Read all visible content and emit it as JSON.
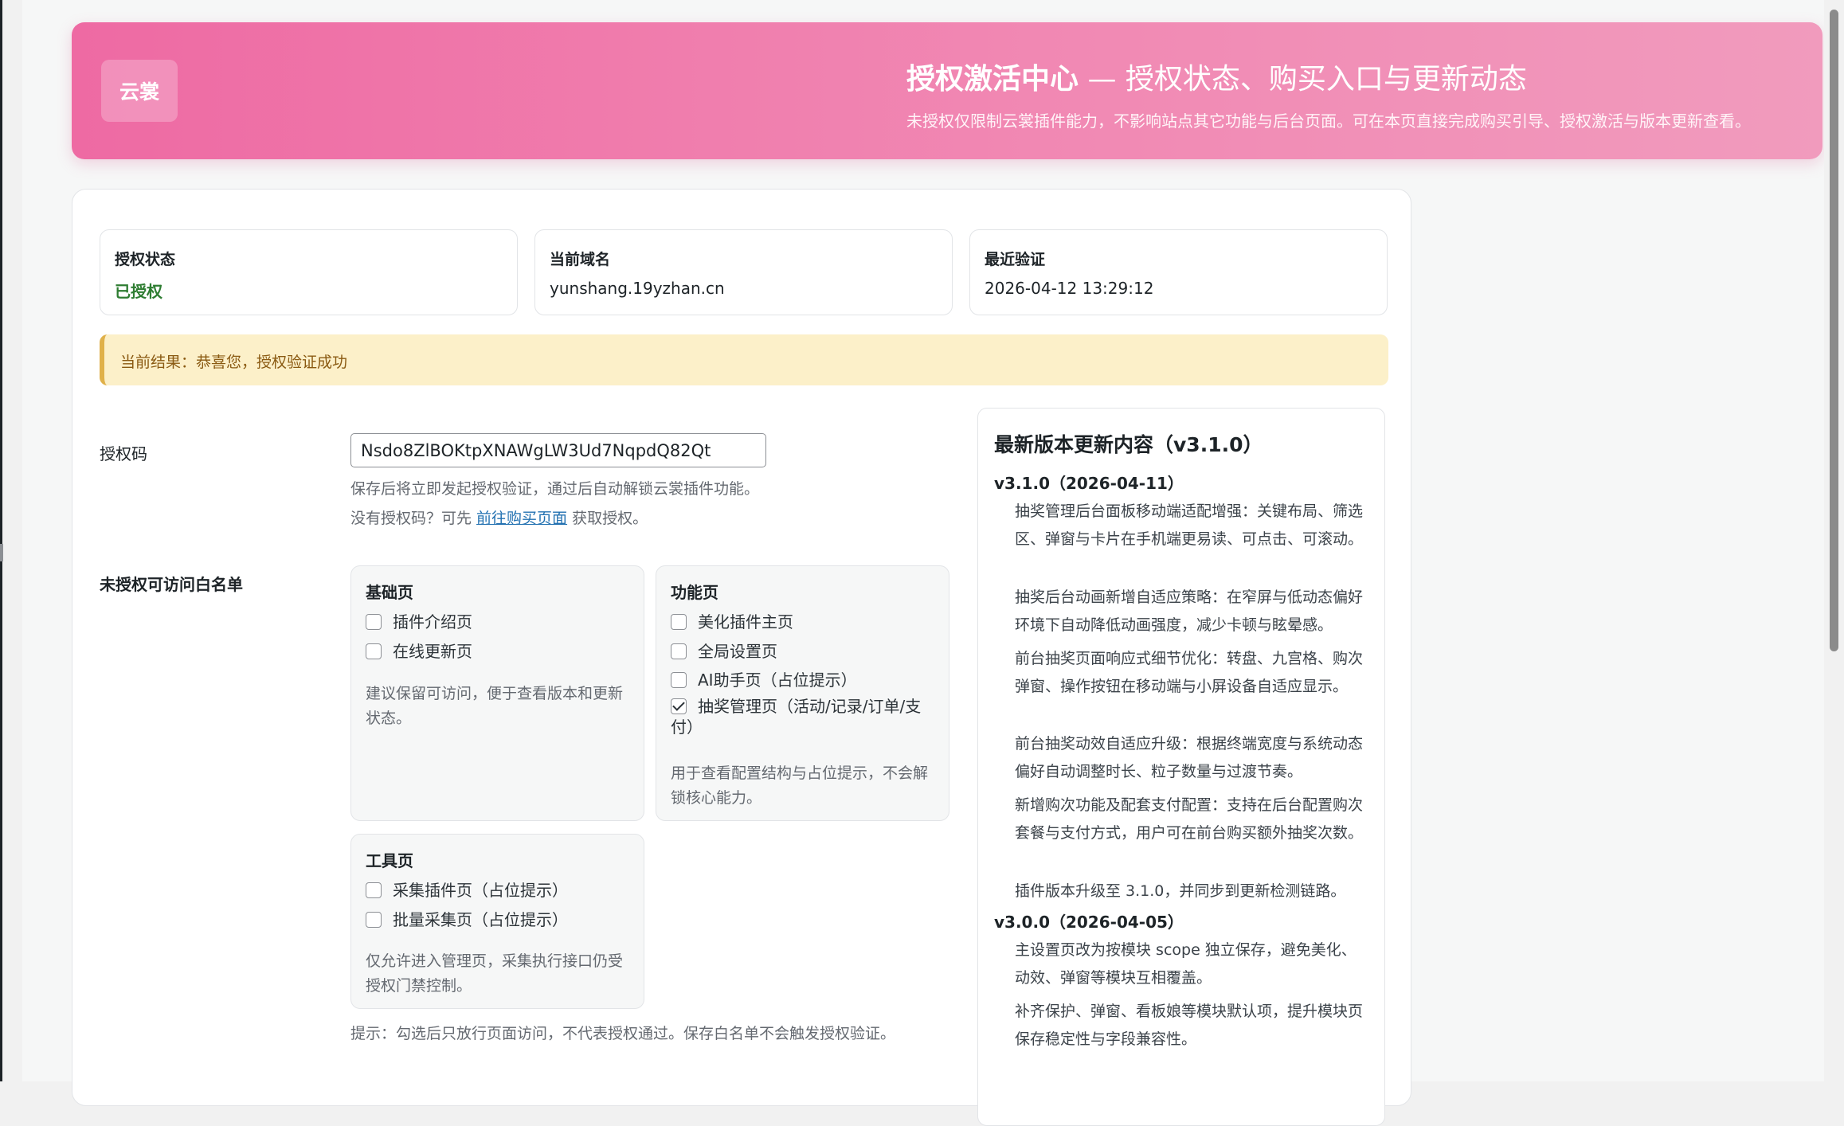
{
  "header": {
    "logo": "云裳",
    "title_main": "授权激活中心",
    "title_rest": " — 授权状态、购买入口与更新动态",
    "subtitle": "未授权仅限制云裳插件能力，不影响站点其它功能与后台页面。可在本页直接完成购买引导、授权激活与版本更新查看。"
  },
  "status_cards": [
    {
      "label": "授权状态",
      "value": "已授权"
    },
    {
      "label": "当前域名",
      "value": "yunshang.19yzhan.cn"
    },
    {
      "label": "最近验证",
      "value": "2026-04-12 13:29:12"
    }
  ],
  "notice": "当前结果：恭喜您，授权验证成功",
  "license": {
    "label": "授权码",
    "value": "Nsdo8ZlBOKtpXNAWgLW3Ud7NqpdQ82Qt",
    "help1": "保存后将立即发起授权验证，通过后自动解锁云裳插件功能。",
    "help2_prefix": "没有授权码？可先 ",
    "help2_link": "前往购买页面",
    "help2_suffix": " 获取授权。"
  },
  "whitelist": {
    "label": "未授权可访问白名单",
    "groups": [
      {
        "title": "基础页",
        "options": [
          {
            "label": "插件介绍页",
            "checked": false
          },
          {
            "label": "在线更新页",
            "checked": false
          }
        ],
        "note": "建议保留可访问，便于查看版本和更新状态。"
      },
      {
        "title": "功能页",
        "options": [
          {
            "label": "美化插件主页",
            "checked": false
          },
          {
            "label": "全局设置页",
            "checked": false
          },
          {
            "label": "AI助手页（占位提示）",
            "checked": false
          },
          {
            "label": "抽奖管理页（活动/记录/订单/支付）",
            "checked": true
          }
        ],
        "note": "用于查看配置结构与占位提示，不会解锁核心能力。"
      },
      {
        "title": "工具页",
        "options": [
          {
            "label": "采集插件页（占位提示）",
            "checked": false
          },
          {
            "label": "批量采集页（占位提示）",
            "checked": false
          }
        ],
        "note": "仅允许进入管理页，采集执行接口仍受授权门禁控制。"
      }
    ],
    "tip": "提示：勾选后只放行页面访问，不代表授权通过。保存白名单不会触发授权验证。"
  },
  "changelog": {
    "title": "最新版本更新内容（v3.1.0）",
    "versions": [
      {
        "version": "v3.1.0（2026-04-11）",
        "items": [
          "抽奖管理后台面板移动端适配增强：关键布局、筛选区、弹窗与卡片在手机端更易读、可点击、可滚动。",
          "抽奖后台动画新增自适应策略：在窄屏与低动态偏好环境下自动降低动画强度，减少卡顿与眩晕感。",
          "前台抽奖页面响应式细节优化：转盘、九宫格、购次弹窗、操作按钮在移动端与小屏设备自适应显示。",
          "前台抽奖动效自适应升级：根据终端宽度与系统动态偏好自动调整时长、粒子数量与过渡节奏。",
          "新增购次功能及配套支付配置：支持在后台配置购次套餐与支付方式，用户可在前台购买额外抽奖次数。",
          "插件版本升级至 3.1.0，并同步到更新检测链路。"
        ]
      },
      {
        "version": "v3.0.0（2026-04-05）",
        "items": [
          "主设置页改为按模块 scope 独立保存，避免美化、动效、弹窗等模块互相覆盖。",
          "补齐保护、弹窗、看板娘等模块默认项，提升模块页保存稳定性与字段兼容性。"
        ]
      }
    ]
  },
  "colors": {
    "hero_start": "#ee6aa3",
    "hero_end": "#f19bbd",
    "success": "#2e7d32",
    "notice_bg": "#fcf0c9",
    "link": "#2271b1"
  }
}
